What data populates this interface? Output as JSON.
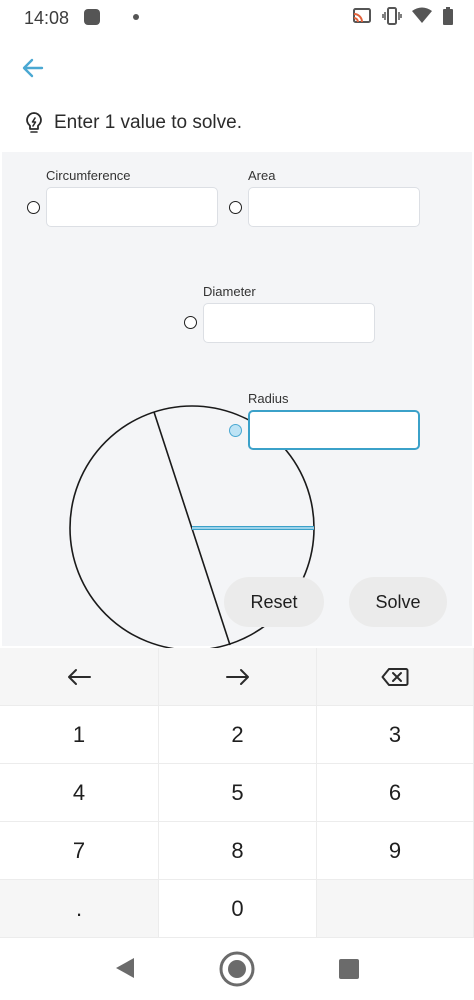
{
  "status_bar": {
    "time": "14:08",
    "icons": [
      "cast-icon",
      "vibrate-icon",
      "wifi-icon",
      "battery-icon"
    ]
  },
  "header": {
    "hint_text": "Enter 1 value to solve."
  },
  "fields": {
    "circumference": {
      "label": "Circumference",
      "value": "",
      "selected": false
    },
    "area": {
      "label": "Area",
      "value": "",
      "selected": false
    },
    "diameter": {
      "label": "Diameter",
      "value": "",
      "selected": false
    },
    "radius": {
      "label": "Radius",
      "value": "",
      "selected": true
    }
  },
  "actions": {
    "reset_label": "Reset",
    "solve_label": "Solve"
  },
  "keypad": {
    "row1": [
      "1",
      "2",
      "3"
    ],
    "row2": [
      "4",
      "5",
      "6"
    ],
    "row3": [
      "7",
      "8",
      "9"
    ],
    "row4": [
      ".",
      "0"
    ]
  },
  "colors": {
    "accent": "#3ba1c9",
    "panel_bg": "#f4f5f7",
    "button_bg": "#ebebeb"
  }
}
